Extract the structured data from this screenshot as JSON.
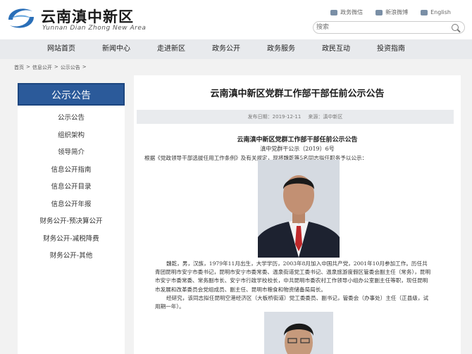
{
  "header": {
    "site_title": "云南滇中新区",
    "site_subtitle": "Yunnan Dian Zhong New Area",
    "top_links": [
      {
        "label": "政务微信",
        "icon": "wechat-icon"
      },
      {
        "label": "新浪微博",
        "icon": "weibo-icon"
      },
      {
        "label": "English",
        "icon": "english-icon"
      }
    ],
    "search_placeholder": "搜索"
  },
  "nav": [
    "网站首页",
    "新闻中心",
    "走进新区",
    "政务公开",
    "政务服务",
    "政民互动",
    "投资指南"
  ],
  "breadcrumb": [
    "首页",
    "信息公开",
    "公示公告"
  ],
  "breadcrumb_sep": ">",
  "sidebar": {
    "title": "公示公告",
    "items": [
      "公示公告",
      "组织架构",
      "领导简介",
      "信息公开指南",
      "信息公开目录",
      "信息公开年报",
      "财务公开-预决算公开",
      "财务公开-减税降费",
      "财务公开-其他"
    ]
  },
  "article": {
    "title": "云南滇中新区党群工作部干部任前公示公告",
    "date_label": "发布日期：2019-12-11",
    "source_label": "来源：滇中新区",
    "notice_title": "云南滇中新区党群工作部干部任前公示公告",
    "notice_num": "滇中党群干公示（2019）6号",
    "intro": "根据《党政领导干部选拔任用工作条例》及有关规定，现将魏乾等5名同志拟任职务予以公示：",
    "bio_1": "魏乾，男，汉族，1979年11月出生，大学学历，2003年8月加入中国共产党，2001年10月参加工作。历任共青团昆明市安宁市委书记，昆明市安宁市委常委、温泉街道党工委书记、温泉旅游度假区管委会副主任（常务），昆明市安宁市委常委、常务副市长、安宁市行政学校校长，中共昆明市委农村工作领导小组办公室副主任等职，现任昆明市发展和改革委员会党组成员、副主任、昆明市粮食和物资储备局局长。",
    "bio_2": "经研究，该同志拟任昆明空港经济区（大板桥街道）党工委委员、副书记，管委会（办事处）主任（正县级，试用期一年）。"
  },
  "colors": {
    "brand_blue": "#2b5a9a",
    "nav_bg": "#e8eaed"
  }
}
